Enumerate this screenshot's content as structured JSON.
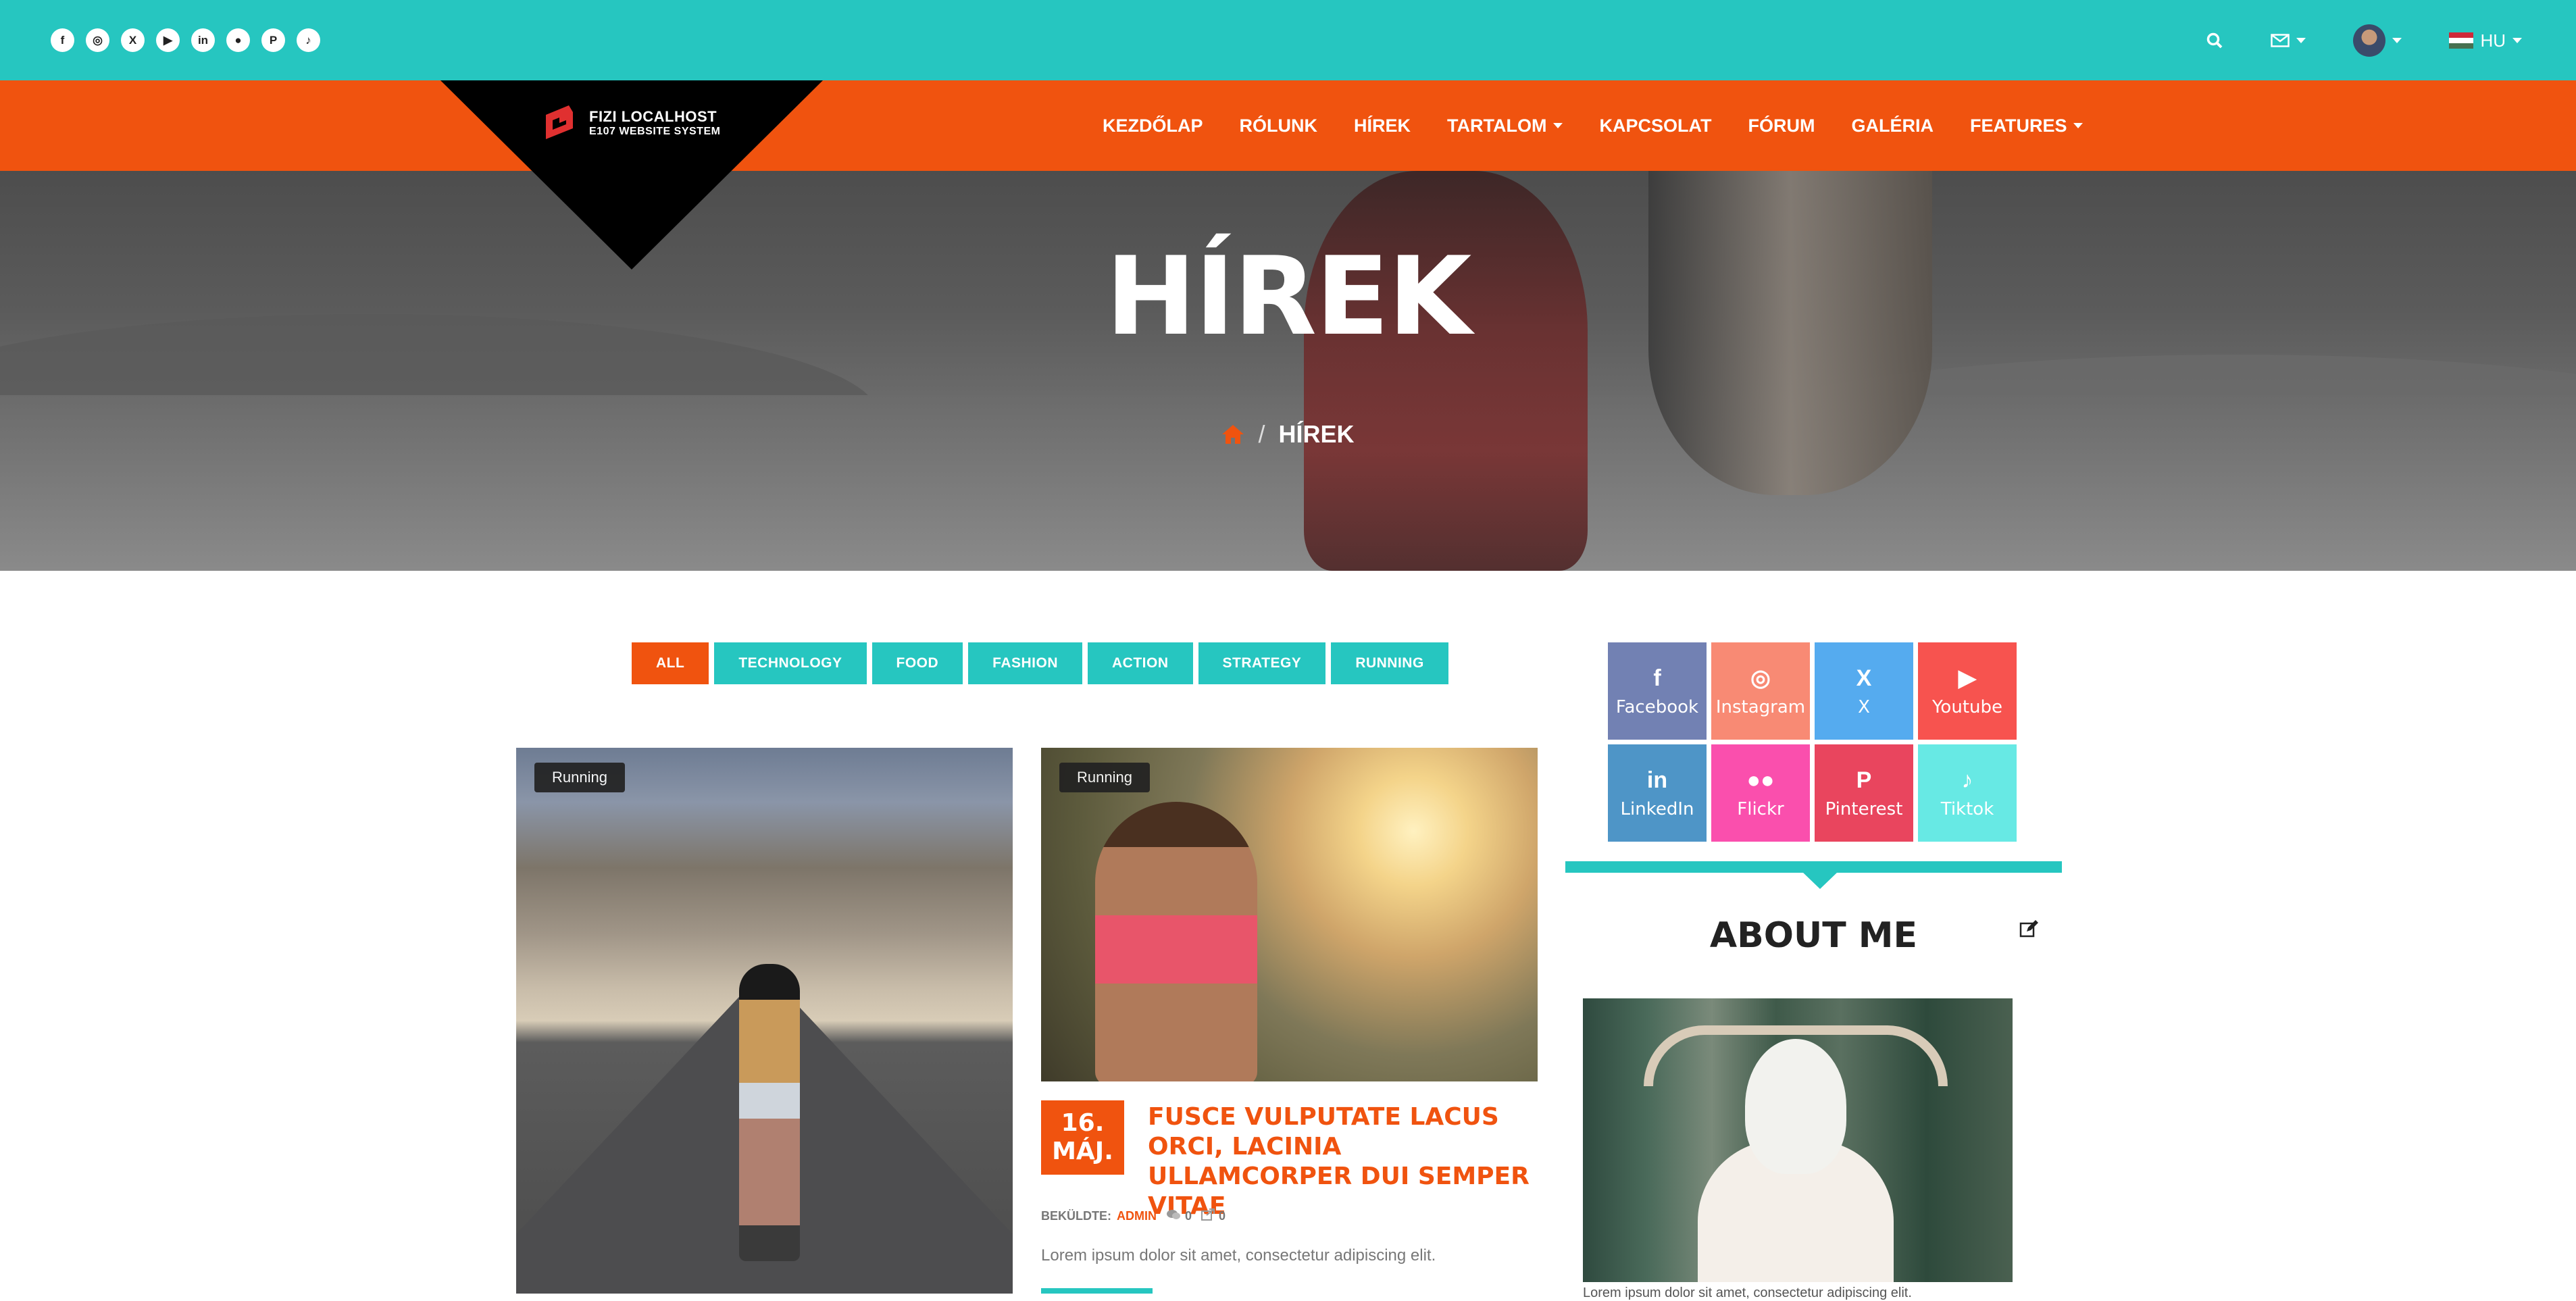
{
  "topbar": {
    "social_icons": [
      "facebook-icon",
      "instagram-icon",
      "x-icon",
      "youtube-icon",
      "linkedin-icon",
      "flickr-icon",
      "pinterest-icon",
      "tiktok-icon"
    ],
    "language": "HU"
  },
  "logo": {
    "line1": "FIZI LOCALHOST",
    "line2": "E107 WEBSITE SYSTEM"
  },
  "nav": {
    "items": [
      {
        "label": "KEZDŐLAP"
      },
      {
        "label": "RÓLUNK"
      },
      {
        "label": "HÍREK"
      },
      {
        "label": "TARTALOM",
        "dropdown": true
      },
      {
        "label": "KAPCSOLAT"
      },
      {
        "label": "FÓRUM"
      },
      {
        "label": "GALÉRIA"
      },
      {
        "label": "FEATURES",
        "dropdown": true
      }
    ]
  },
  "hero": {
    "title": "HÍREK",
    "breadcrumb_current": "HÍREK",
    "breadcrumb_sep": "/"
  },
  "filters": [
    "ALL",
    "TECHNOLOGY",
    "FOOD",
    "FASHION",
    "ACTION",
    "STRATEGY",
    "RUNNING"
  ],
  "posts": [
    {
      "tag": "Running"
    },
    {
      "tag": "Running",
      "day": "16.",
      "month": "MÁJ.",
      "title": "FUSCE VULPUTATE LACUS ORCI, LACINIA ULLAMCORPER DUI SEMPER VITAE",
      "meta_label": "BEKÜLDTE:",
      "author": "ADMIN",
      "comments": "0",
      "shares": "0",
      "excerpt": "Lorem ipsum dolor sit amet, consectetur adipiscing elit."
    }
  ],
  "sidebar": {
    "social_boxes": [
      {
        "label": "Facebook",
        "glyph": "f",
        "color": "#7281b3"
      },
      {
        "label": "Instagram",
        "glyph": "◎",
        "color": "#f88a74"
      },
      {
        "label": "X",
        "glyph": "X",
        "color": "#55abef"
      },
      {
        "label": "Youtube",
        "glyph": "▶",
        "color": "#f7534f"
      },
      {
        "label": "LinkedIn",
        "glyph": "in",
        "color": "#4e95c7"
      },
      {
        "label": "Flickr",
        "glyph": "●●",
        "color": "#fa4fad"
      },
      {
        "label": "Pinterest",
        "glyph": "P",
        "color": "#e9455e"
      },
      {
        "label": "Tiktok",
        "glyph": "♪",
        "color": "#67e9e4"
      }
    ],
    "about_title": "ABOUT ME",
    "about_text": "Lorem ipsum dolor sit amet, consectetur adipiscing elit."
  },
  "colors": {
    "teal": "#26c6c0",
    "orange": "#f0530f"
  }
}
